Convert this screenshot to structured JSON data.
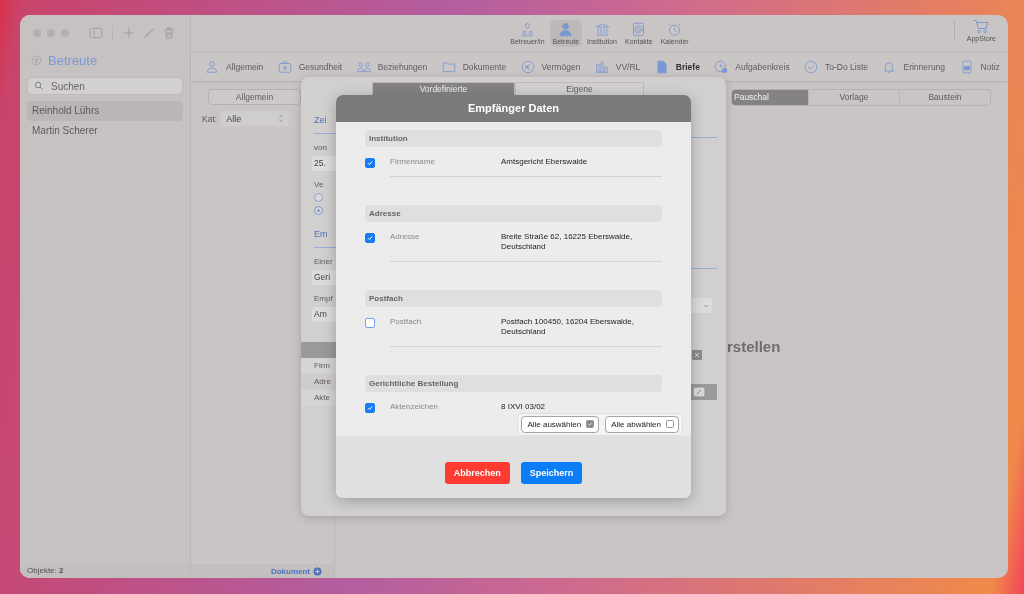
{
  "sidebar": {
    "title": "Betreute",
    "search": {
      "placeholder": "Suchen"
    },
    "items": [
      {
        "label": "Reinhold Lührs",
        "selected": true
      },
      {
        "label": "Martin Scherer",
        "selected": false
      }
    ],
    "footer": "Objekte: **2**"
  },
  "top_nav": [
    {
      "label": "Betreuer/in",
      "selected": false
    },
    {
      "label": "Betreute",
      "selected": true
    },
    {
      "label": "Institution",
      "selected": false
    },
    {
      "label": "Kontakte",
      "selected": false
    },
    {
      "label": "Kalender",
      "selected": false
    }
  ],
  "store": "AppStore",
  "tabs": [
    {
      "label": "Allgemein",
      "selected": false
    },
    {
      "label": "Gesundheit",
      "selected": false
    },
    {
      "label": "Beziehungen",
      "selected": false
    },
    {
      "label": "Dokumente",
      "selected": false
    },
    {
      "label": "Vermögen",
      "selected": false
    },
    {
      "label": "VV/RL",
      "selected": false
    },
    {
      "label": "Briefe",
      "selected": true
    },
    {
      "label": "Aufgabenkreis",
      "selected": false
    },
    {
      "label": "To-Do Liste",
      "selected": false
    },
    {
      "label": "Erinnerung",
      "selected": false
    },
    {
      "label": "Notiz",
      "selected": false
    }
  ],
  "middle": {
    "button": "Allgemein",
    "filter_label": "Kat:",
    "filter_value": "Alle",
    "footer": "Dokument"
  },
  "segments": [
    {
      "label": "Pauschal",
      "selected": true
    },
    {
      "label": "Vorlage",
      "selected": false
    },
    {
      "label": "Baustein",
      "selected": false
    }
  ],
  "heading_fragment": "rstellen",
  "sheet": {
    "tabs": [
      {
        "label": "Vordefinierte",
        "selected": true
      },
      {
        "label": "Eigene",
        "selected": false
      }
    ],
    "fragments": [
      {
        "kind": "tab-label",
        "text": "Zei"
      },
      {
        "kind": "label",
        "text": "von"
      },
      {
        "kind": "field",
        "text": "25."
      },
      {
        "kind": "label",
        "text": "Ve"
      },
      {
        "kind": "radio",
        "selected": false
      },
      {
        "kind": "radio",
        "selected": true
      },
      {
        "kind": "tab-label",
        "text": "Em"
      },
      {
        "kind": "label",
        "text": "Einer"
      },
      {
        "kind": "field",
        "text": "Geri"
      },
      {
        "kind": "label",
        "text": "Empf"
      },
      {
        "kind": "field",
        "text": "Am"
      },
      {
        "kind": "table-header"
      },
      {
        "kind": "row",
        "text": "Firm"
      },
      {
        "kind": "row",
        "text": "Adre"
      },
      {
        "kind": "row",
        "text": "Akte"
      }
    ]
  },
  "dialog": {
    "title": "Empfänger Daten",
    "sections": [
      {
        "title": "Institution",
        "fields": [
          {
            "label": "Firmenname",
            "value": "Amtsgericht Eberswalde",
            "checked": true
          }
        ]
      },
      {
        "title": "Adresse",
        "fields": [
          {
            "label": "Adresse",
            "value": "Breite Straße 62, 16225 Eberswalde, Deutschland",
            "checked": true
          }
        ]
      },
      {
        "title": "Postfach",
        "fields": [
          {
            "label": "Postfach",
            "value": "Postfach 100450, 16204 Eberswalde, Deutschland",
            "checked": false
          }
        ]
      },
      {
        "title": "Gerichtliche Bestellung",
        "fields": [
          {
            "label": "Aktenzeichen",
            "value": "8 IXVI 03/02",
            "checked": true
          }
        ]
      }
    ],
    "select_all": {
      "label": "Alle auswählen",
      "checked": true
    },
    "deselect_all": {
      "label": "Alle abwählen",
      "checked": false
    },
    "buttons": [
      {
        "label": "Abbrechen",
        "kind": "cancel"
      },
      {
        "label": "Speichern",
        "kind": "save"
      }
    ]
  }
}
